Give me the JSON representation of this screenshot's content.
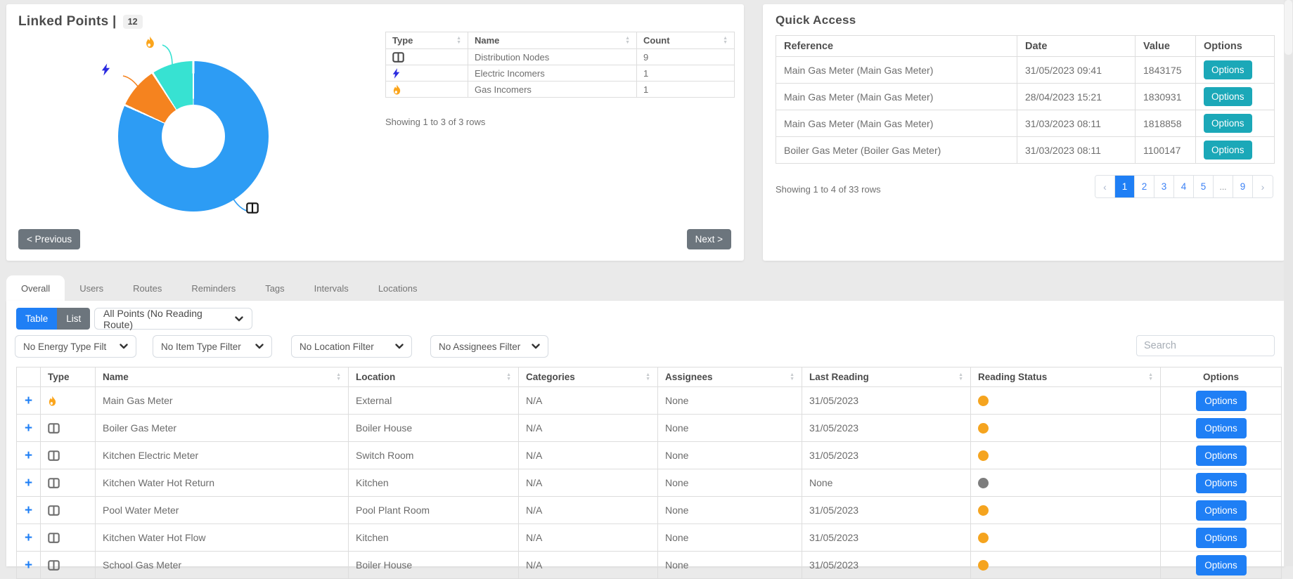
{
  "colors": {
    "primary_blue": "#1F7FF5",
    "teal": "#1BA8B8",
    "gray_button": "#6C757D",
    "donut_blue": "#2D9CF4",
    "donut_orange": "#F5831F",
    "donut_cyan": "#37E2D2",
    "status_orange": "#F5A41F",
    "status_gray": "#7D7D7D",
    "bolt_blue": "#2B2BE0",
    "flame_amber": "#FBA51C"
  },
  "linked_points": {
    "title": "Linked Points |",
    "badge": "12",
    "chart_data": {
      "type": "pie",
      "donut": true,
      "title": "Linked Points",
      "categories": [
        "Distribution Nodes",
        "Electric Incomers",
        "Gas Incomers"
      ],
      "values": [
        9,
        1,
        1
      ],
      "colors": [
        "#2D9CF4",
        "#F5831F",
        "#37E2D2"
      ],
      "legend_position": "callout-icons"
    },
    "mini_table": {
      "headers": [
        "Type",
        "Name",
        "Count"
      ],
      "rows": [
        {
          "icon": "distribution-node-icon",
          "name": "Distribution Nodes",
          "count": "9"
        },
        {
          "icon": "electric-bolt-icon",
          "name": "Electric Incomers",
          "count": "1"
        },
        {
          "icon": "gas-flame-icon",
          "name": "Gas Incomers",
          "count": "1"
        }
      ]
    },
    "summary": "Showing 1 to 3 of 3 rows",
    "previous_label": "< Previous",
    "next_label": "Next >"
  },
  "quick_access": {
    "title": "Quick Access",
    "headers": {
      "reference": "Reference",
      "date": "Date",
      "value": "Value",
      "options": "Options"
    },
    "options_label": "Options",
    "rows": [
      {
        "reference": "Main Gas Meter (Main Gas Meter)",
        "date": "31/05/2023 09:41",
        "value": "1843175"
      },
      {
        "reference": "Main Gas Meter (Main Gas Meter)",
        "date": "28/04/2023 15:21",
        "value": "1830931"
      },
      {
        "reference": "Main Gas Meter (Main Gas Meter)",
        "date": "31/03/2023 08:11",
        "value": "1818858"
      },
      {
        "reference": "Boiler Gas Meter (Boiler Gas Meter)",
        "date": "31/03/2023 08:11",
        "value": "1100147"
      }
    ],
    "summary": "Showing 1 to 4 of 33 rows",
    "pagination": {
      "prev": "‹",
      "pages": [
        "1",
        "2",
        "3",
        "4",
        "5",
        "...",
        "9"
      ],
      "active_page": "1",
      "next": "›"
    }
  },
  "tabs": {
    "active": "Overall",
    "items": [
      "Overall",
      "Users",
      "Routes",
      "Reminders",
      "Tags",
      "Intervals",
      "Locations"
    ]
  },
  "toolbar": {
    "table_label": "Table",
    "list_label": "List",
    "route_select_value": "All Points (No Reading Route)"
  },
  "filters": {
    "energy_type": "No Energy Type Filt",
    "item_type": "No Item Type Filter",
    "location": "No Location Filter",
    "assignees": "No Assignees Filter",
    "search_placeholder": "Search"
  },
  "main_table": {
    "headers": {
      "type": "Type",
      "name": "Name",
      "location": "Location",
      "categories": "Categories",
      "assignees": "Assignees",
      "last_reading": "Last Reading",
      "reading_status": "Reading Status",
      "options": "Options"
    },
    "options_label": "Options",
    "rows": [
      {
        "icon": "gas-flame-icon",
        "name": "Main Gas Meter",
        "location": "External",
        "categories": "N/A",
        "assignees": "None",
        "last_reading": "31/05/2023",
        "status": "orange"
      },
      {
        "icon": "distribution-node-icon",
        "name": "Boiler Gas Meter",
        "location": "Boiler House",
        "categories": "N/A",
        "assignees": "None",
        "last_reading": "31/05/2023",
        "status": "orange"
      },
      {
        "icon": "distribution-node-icon",
        "name": "Kitchen Electric Meter",
        "location": "Switch Room",
        "categories": "N/A",
        "assignees": "None",
        "last_reading": "31/05/2023",
        "status": "orange"
      },
      {
        "icon": "distribution-node-icon",
        "name": "Kitchen Water Hot Return",
        "location": "Kitchen",
        "categories": "N/A",
        "assignees": "None",
        "last_reading": "None",
        "status": "gray"
      },
      {
        "icon": "distribution-node-icon",
        "name": "Pool Water Meter",
        "location": "Pool Plant Room",
        "categories": "N/A",
        "assignees": "None",
        "last_reading": "31/05/2023",
        "status": "orange"
      },
      {
        "icon": "distribution-node-icon",
        "name": "Kitchen Water Hot Flow",
        "location": "Kitchen",
        "categories": "N/A",
        "assignees": "None",
        "last_reading": "31/05/2023",
        "status": "orange"
      },
      {
        "icon": "distribution-node-icon",
        "name": "School Gas Meter",
        "location": "Boiler House",
        "categories": "N/A",
        "assignees": "None",
        "last_reading": "31/05/2023",
        "status": "orange"
      }
    ]
  }
}
